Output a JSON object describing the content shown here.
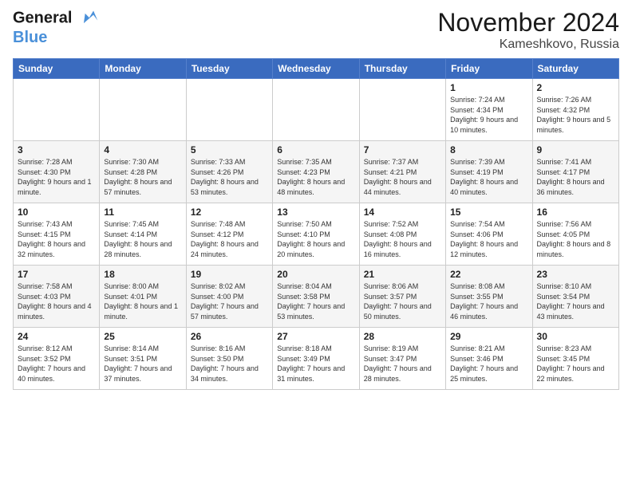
{
  "logo": {
    "line1": "General",
    "line2": "Blue"
  },
  "title": "November 2024",
  "location": "Kameshkovo, Russia",
  "days_of_week": [
    "Sunday",
    "Monday",
    "Tuesday",
    "Wednesday",
    "Thursday",
    "Friday",
    "Saturday"
  ],
  "weeks": [
    [
      {
        "day": "",
        "sunrise": "",
        "sunset": "",
        "daylight": ""
      },
      {
        "day": "",
        "sunrise": "",
        "sunset": "",
        "daylight": ""
      },
      {
        "day": "",
        "sunrise": "",
        "sunset": "",
        "daylight": ""
      },
      {
        "day": "",
        "sunrise": "",
        "sunset": "",
        "daylight": ""
      },
      {
        "day": "",
        "sunrise": "",
        "sunset": "",
        "daylight": ""
      },
      {
        "day": "1",
        "sunrise": "Sunrise: 7:24 AM",
        "sunset": "Sunset: 4:34 PM",
        "daylight": "Daylight: 9 hours and 10 minutes."
      },
      {
        "day": "2",
        "sunrise": "Sunrise: 7:26 AM",
        "sunset": "Sunset: 4:32 PM",
        "daylight": "Daylight: 9 hours and 5 minutes."
      }
    ],
    [
      {
        "day": "3",
        "sunrise": "Sunrise: 7:28 AM",
        "sunset": "Sunset: 4:30 PM",
        "daylight": "Daylight: 9 hours and 1 minute."
      },
      {
        "day": "4",
        "sunrise": "Sunrise: 7:30 AM",
        "sunset": "Sunset: 4:28 PM",
        "daylight": "Daylight: 8 hours and 57 minutes."
      },
      {
        "day": "5",
        "sunrise": "Sunrise: 7:33 AM",
        "sunset": "Sunset: 4:26 PM",
        "daylight": "Daylight: 8 hours and 53 minutes."
      },
      {
        "day": "6",
        "sunrise": "Sunrise: 7:35 AM",
        "sunset": "Sunset: 4:23 PM",
        "daylight": "Daylight: 8 hours and 48 minutes."
      },
      {
        "day": "7",
        "sunrise": "Sunrise: 7:37 AM",
        "sunset": "Sunset: 4:21 PM",
        "daylight": "Daylight: 8 hours and 44 minutes."
      },
      {
        "day": "8",
        "sunrise": "Sunrise: 7:39 AM",
        "sunset": "Sunset: 4:19 PM",
        "daylight": "Daylight: 8 hours and 40 minutes."
      },
      {
        "day": "9",
        "sunrise": "Sunrise: 7:41 AM",
        "sunset": "Sunset: 4:17 PM",
        "daylight": "Daylight: 8 hours and 36 minutes."
      }
    ],
    [
      {
        "day": "10",
        "sunrise": "Sunrise: 7:43 AM",
        "sunset": "Sunset: 4:15 PM",
        "daylight": "Daylight: 8 hours and 32 minutes."
      },
      {
        "day": "11",
        "sunrise": "Sunrise: 7:45 AM",
        "sunset": "Sunset: 4:14 PM",
        "daylight": "Daylight: 8 hours and 28 minutes."
      },
      {
        "day": "12",
        "sunrise": "Sunrise: 7:48 AM",
        "sunset": "Sunset: 4:12 PM",
        "daylight": "Daylight: 8 hours and 24 minutes."
      },
      {
        "day": "13",
        "sunrise": "Sunrise: 7:50 AM",
        "sunset": "Sunset: 4:10 PM",
        "daylight": "Daylight: 8 hours and 20 minutes."
      },
      {
        "day": "14",
        "sunrise": "Sunrise: 7:52 AM",
        "sunset": "Sunset: 4:08 PM",
        "daylight": "Daylight: 8 hours and 16 minutes."
      },
      {
        "day": "15",
        "sunrise": "Sunrise: 7:54 AM",
        "sunset": "Sunset: 4:06 PM",
        "daylight": "Daylight: 8 hours and 12 minutes."
      },
      {
        "day": "16",
        "sunrise": "Sunrise: 7:56 AM",
        "sunset": "Sunset: 4:05 PM",
        "daylight": "Daylight: 8 hours and 8 minutes."
      }
    ],
    [
      {
        "day": "17",
        "sunrise": "Sunrise: 7:58 AM",
        "sunset": "Sunset: 4:03 PM",
        "daylight": "Daylight: 8 hours and 4 minutes."
      },
      {
        "day": "18",
        "sunrise": "Sunrise: 8:00 AM",
        "sunset": "Sunset: 4:01 PM",
        "daylight": "Daylight: 8 hours and 1 minute."
      },
      {
        "day": "19",
        "sunrise": "Sunrise: 8:02 AM",
        "sunset": "Sunset: 4:00 PM",
        "daylight": "Daylight: 7 hours and 57 minutes."
      },
      {
        "day": "20",
        "sunrise": "Sunrise: 8:04 AM",
        "sunset": "Sunset: 3:58 PM",
        "daylight": "Daylight: 7 hours and 53 minutes."
      },
      {
        "day": "21",
        "sunrise": "Sunrise: 8:06 AM",
        "sunset": "Sunset: 3:57 PM",
        "daylight": "Daylight: 7 hours and 50 minutes."
      },
      {
        "day": "22",
        "sunrise": "Sunrise: 8:08 AM",
        "sunset": "Sunset: 3:55 PM",
        "daylight": "Daylight: 7 hours and 46 minutes."
      },
      {
        "day": "23",
        "sunrise": "Sunrise: 8:10 AM",
        "sunset": "Sunset: 3:54 PM",
        "daylight": "Daylight: 7 hours and 43 minutes."
      }
    ],
    [
      {
        "day": "24",
        "sunrise": "Sunrise: 8:12 AM",
        "sunset": "Sunset: 3:52 PM",
        "daylight": "Daylight: 7 hours and 40 minutes."
      },
      {
        "day": "25",
        "sunrise": "Sunrise: 8:14 AM",
        "sunset": "Sunset: 3:51 PM",
        "daylight": "Daylight: 7 hours and 37 minutes."
      },
      {
        "day": "26",
        "sunrise": "Sunrise: 8:16 AM",
        "sunset": "Sunset: 3:50 PM",
        "daylight": "Daylight: 7 hours and 34 minutes."
      },
      {
        "day": "27",
        "sunrise": "Sunrise: 8:18 AM",
        "sunset": "Sunset: 3:49 PM",
        "daylight": "Daylight: 7 hours and 31 minutes."
      },
      {
        "day": "28",
        "sunrise": "Sunrise: 8:19 AM",
        "sunset": "Sunset: 3:47 PM",
        "daylight": "Daylight: 7 hours and 28 minutes."
      },
      {
        "day": "29",
        "sunrise": "Sunrise: 8:21 AM",
        "sunset": "Sunset: 3:46 PM",
        "daylight": "Daylight: 7 hours and 25 minutes."
      },
      {
        "day": "30",
        "sunrise": "Sunrise: 8:23 AM",
        "sunset": "Sunset: 3:45 PM",
        "daylight": "Daylight: 7 hours and 22 minutes."
      }
    ]
  ]
}
